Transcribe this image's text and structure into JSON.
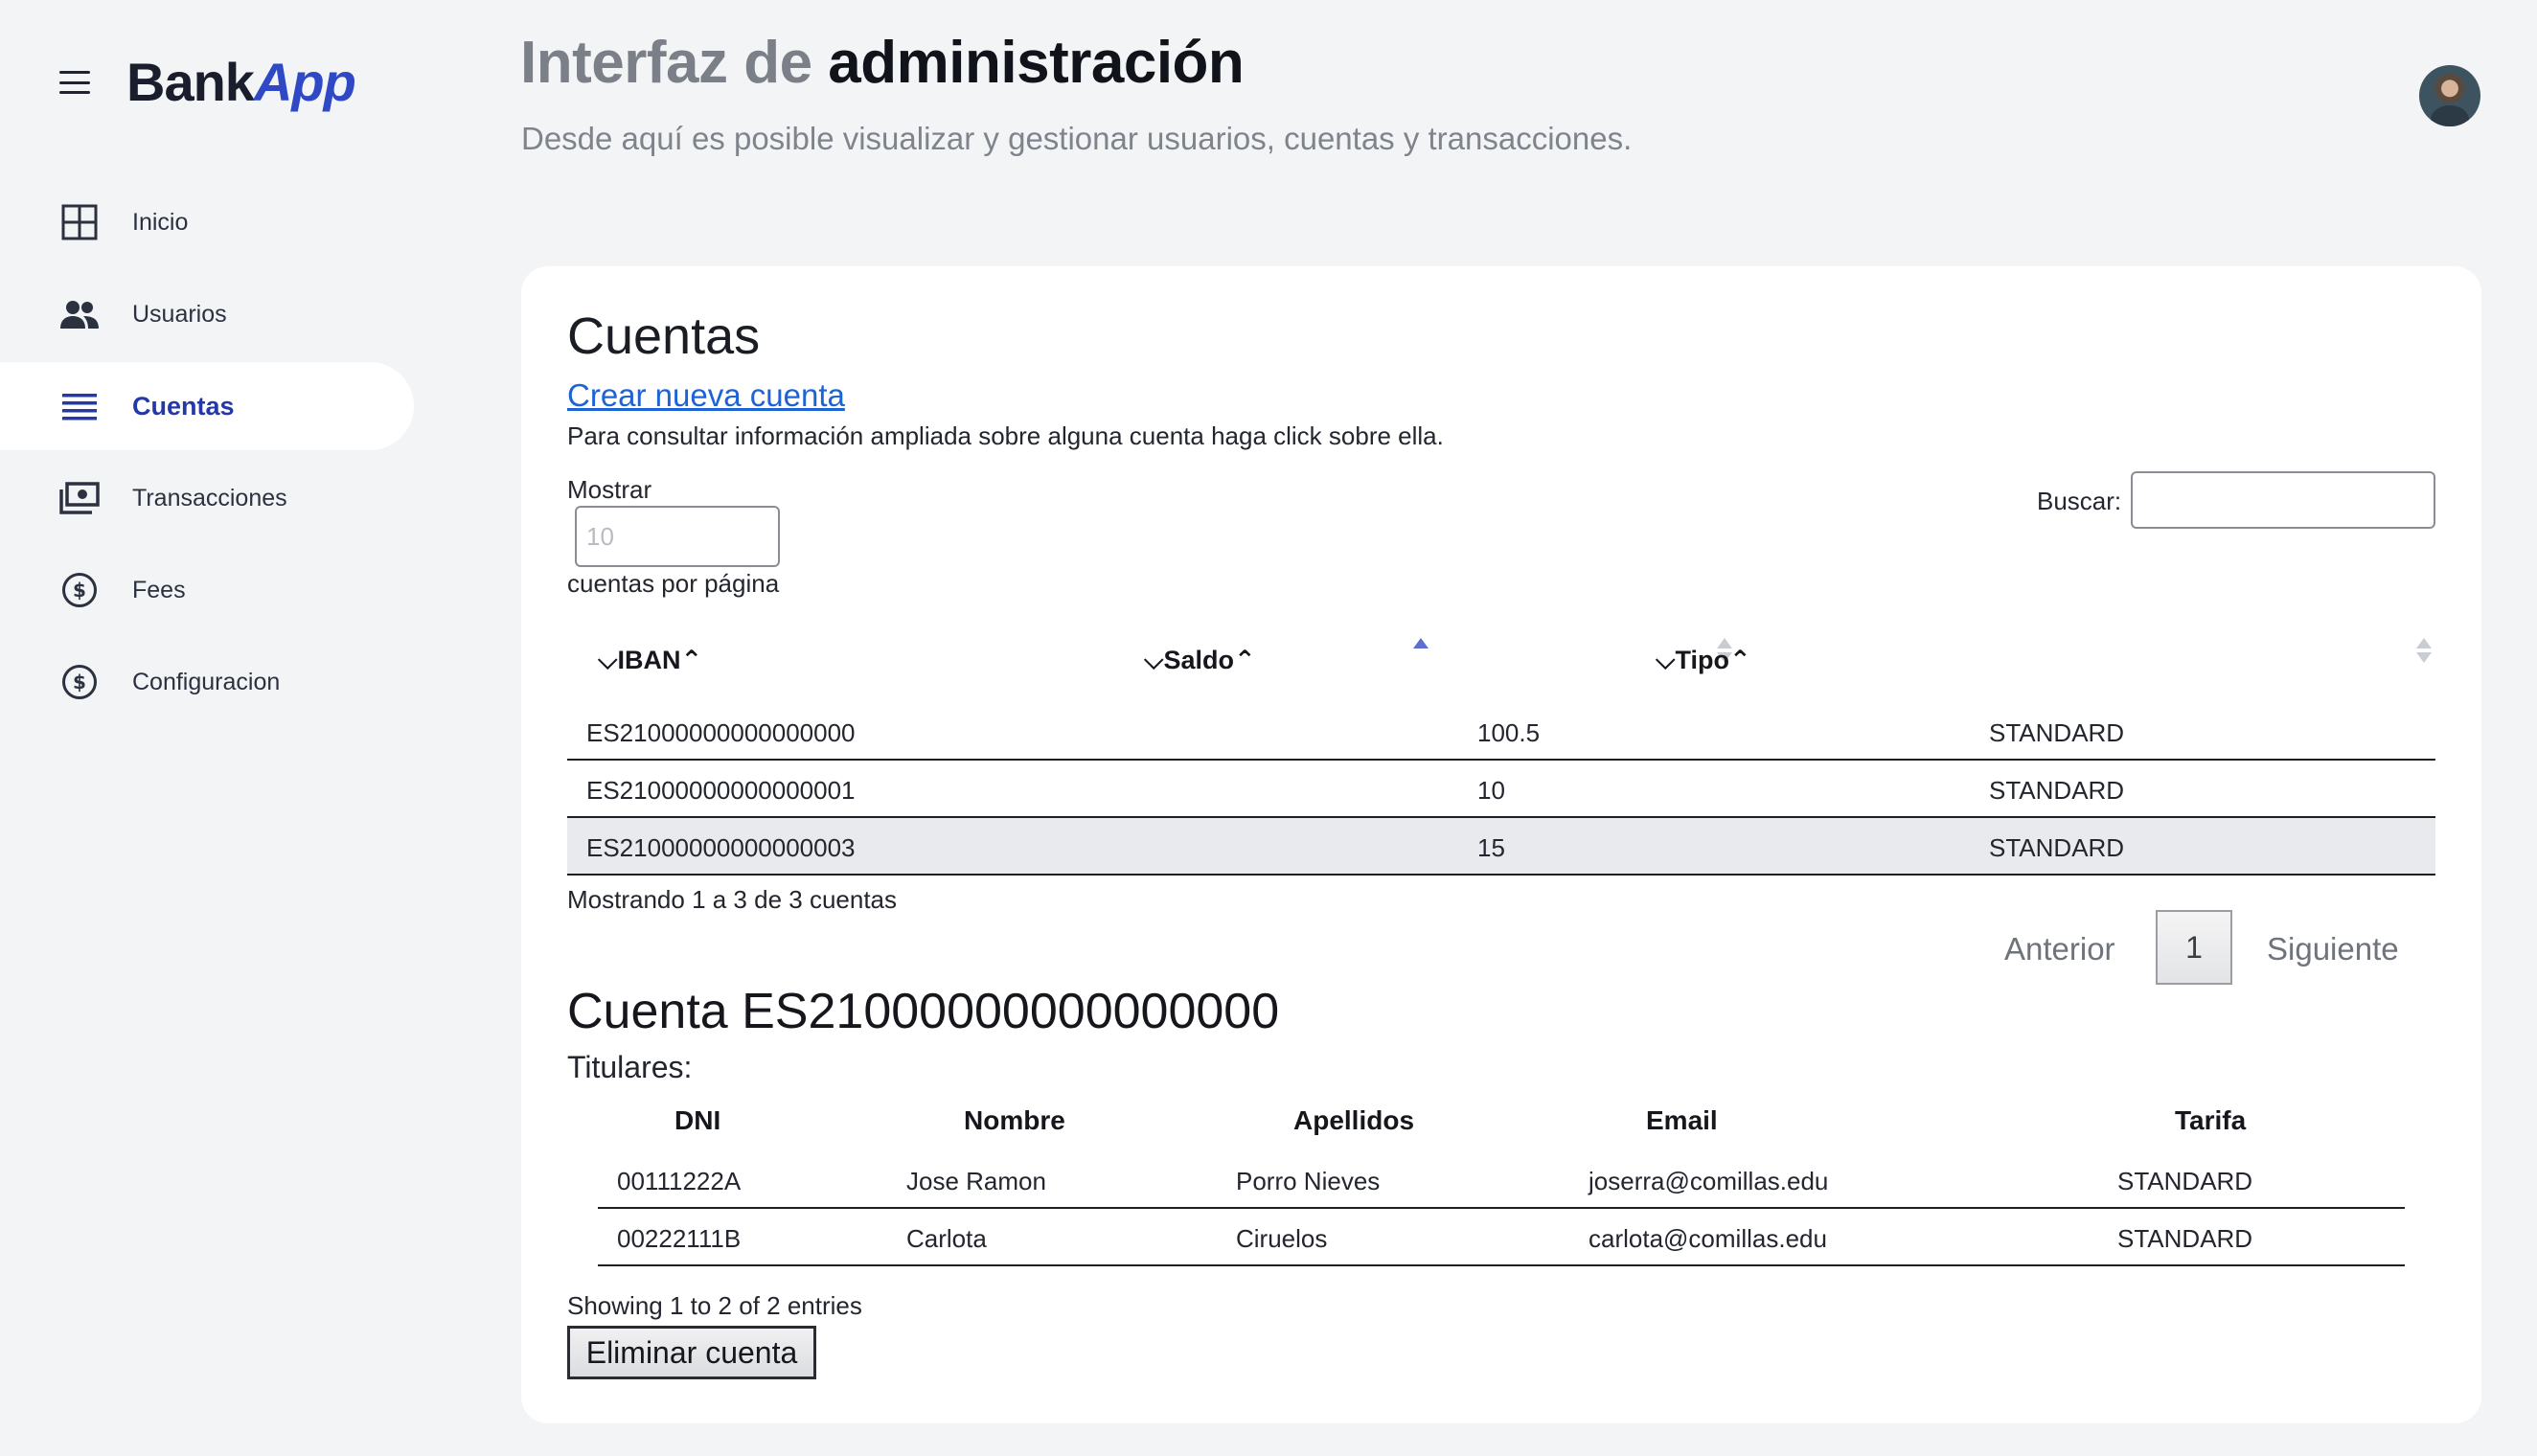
{
  "brand": {
    "part1": "Bank",
    "part2": "App"
  },
  "sidebar": {
    "items": [
      {
        "label": "Inicio",
        "icon": "grid-icon"
      },
      {
        "label": "Usuarios",
        "icon": "users-icon"
      },
      {
        "label": "Cuentas",
        "icon": "list-icon",
        "active": true
      },
      {
        "label": "Transacciones",
        "icon": "money-icon"
      },
      {
        "label": "Fees",
        "icon": "dollar-circle-icon"
      },
      {
        "label": "Configuracion",
        "icon": "dollar-circle-icon"
      }
    ]
  },
  "header": {
    "title_light": "Interfaz de ",
    "title_bold": "administración",
    "subtitle": "Desde aquí es posible visualizar y gestionar usuarios, cuentas y transacciones."
  },
  "accounts": {
    "heading": "Cuentas",
    "create_link": "Crear nueva cuenta",
    "info": "Para consultar información ampliada sobre alguna cuenta haga click sobre ella.",
    "show_label": "Mostrar",
    "page_size_placeholder": "10",
    "per_page_label": "cuentas por página",
    "search_label": "Buscar:",
    "search_value": "",
    "columns": [
      "IBAN",
      "Saldo",
      "Tipo"
    ],
    "sorted_column": "IBAN",
    "rows": [
      [
        "ES21000000000000000",
        "100.5",
        "STANDARD"
      ],
      [
        "ES21000000000000001",
        "10",
        "STANDARD"
      ],
      [
        "ES21000000000000003",
        "15",
        "STANDARD"
      ]
    ],
    "showing": "Mostrando 1 a 3 de 3 cuentas",
    "pager": {
      "prev": "Anterior",
      "page": "1",
      "next": "Siguiente"
    }
  },
  "detail": {
    "title": "Cuenta ES21000000000000000",
    "holders_label": "Titulares:",
    "columns": [
      "DNI",
      "Nombre",
      "Apellidos",
      "Email",
      "Tarifa"
    ],
    "rows": [
      [
        "00111222A",
        "Jose Ramon",
        "Porro Nieves",
        "joserra@comillas.edu",
        "STANDARD"
      ],
      [
        "00222111B",
        "Carlota",
        "Ciruelos",
        "carlota@comillas.edu",
        "STANDARD"
      ]
    ],
    "showing": "Showing 1 to 2 of 2 entries",
    "delete_button": "Eliminar cuenta"
  },
  "colors": {
    "accent": "#2438a8",
    "brand_app": "#2f49c6",
    "link": "#1e63d6",
    "background": "#f3f4f6"
  }
}
